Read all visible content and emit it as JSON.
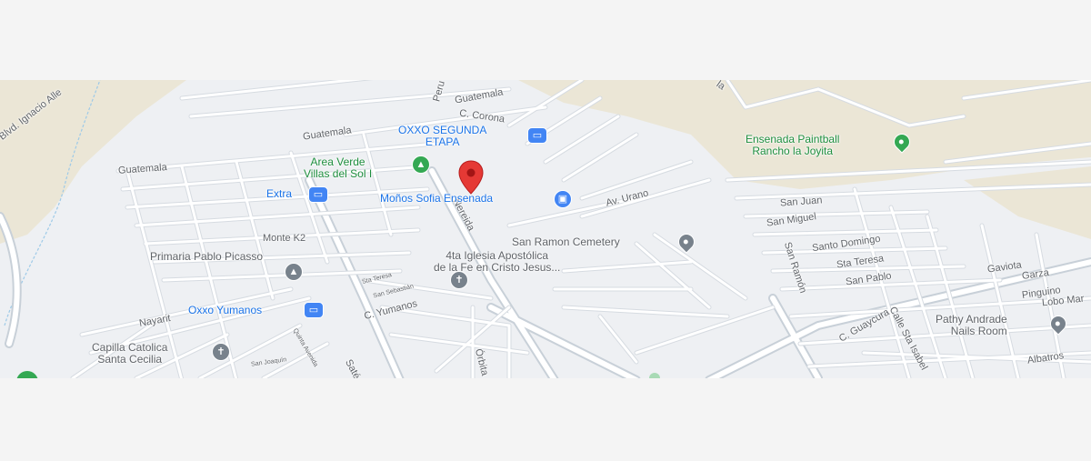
{
  "colors": {
    "background": "#f4f4f4",
    "map_base": "#eef0f3",
    "terrain": "#ebe6d6",
    "poi_green": "#34a853",
    "poi_blue": "#4285f4",
    "poi_gray": "#78828c",
    "marker_red": "#e53935"
  },
  "streets": {
    "blvd_ignacio": "Blvd. Ignacio Alle",
    "guatemala_west": "Guatemala",
    "guatemala_mid": "Guatemala",
    "guatemala_north": "Guatemala",
    "peru": "Peru",
    "la": "la",
    "c_corona": "C. Corona",
    "nereida": "Nereida",
    "av_urano": "Av. Urano",
    "monte_k2": "Monte K2",
    "nayarit": "Nayarit",
    "c_yumanos": "C. Yumanos",
    "sta_teresa_small": "Sta Teresa",
    "san_sebastian": "San Sebastián",
    "san_joaquin": "San Joaquín",
    "quinta_avenida": "Quinta Avenida",
    "sate": "Saté",
    "orbita": "Órbita",
    "san_juan": "San Juan",
    "san_miguel": "San Miguel",
    "san_ramon": "San Ramón",
    "santo_domingo": "Santo Domingo",
    "sta_teresa": "Sta Teresa",
    "san_pablo": "San Pablo",
    "gaviota": "Gaviota",
    "garza": "Garza",
    "pinguino": "Pinguino",
    "lobo_mar": "Lobo Mar",
    "c_guaycura": "C. Guaycura",
    "calle_sta_isabel": "Calle Sta Isabel",
    "albatros": "Albatros"
  },
  "pois": {
    "oxxo_segunda": "OXXO SEGUNDA ETAPA",
    "area_verde": "Area Verde Villas del Sol I",
    "extra": "Extra",
    "monos_sofia": "Moños Sofia Ensenada",
    "ensenada_paintball": "Ensenada Paintball Rancho la Joyita",
    "san_ramon_cemetery": "San Ramon Cemetery",
    "primaria_pablo_picasso": "Primaria Pablo Picasso",
    "iglesia_4ta": "4ta Iglesia Apostólica de la Fe en Cristo Jesus...",
    "oxxo_yumanos": "Oxxo Yumanos",
    "capilla_catolica": "Capilla Catolica Santa Cecilia",
    "pathy_andrade": "Pathy Andrade Nails Room"
  },
  "poi_lines": {
    "oxxo_segunda": [
      "OXXO SEGUNDA",
      "ETAPA"
    ],
    "area_verde": [
      "Area Verde",
      "Villas del Sol I"
    ],
    "ensenada_paintball": [
      "Ensenada Paintball",
      "Rancho la Joyita"
    ],
    "iglesia_4ta": [
      "4ta Iglesia Apostólica",
      "de la Fe en Cristo Jesus..."
    ],
    "capilla_catolica": [
      "Capilla Catolica",
      "Santa Cecilia"
    ],
    "pathy_andrade": [
      "Pathy Andrade",
      "Nails Room"
    ]
  },
  "icons": {
    "park": "tree-icon",
    "store": "shopping-bag-icon",
    "convenience": "store-icon",
    "cemetery": "cemetery-pin-icon",
    "school": "school-icon",
    "church": "church-cross-icon",
    "location": "location-pin-icon",
    "selected": "red-location-marker-icon"
  }
}
